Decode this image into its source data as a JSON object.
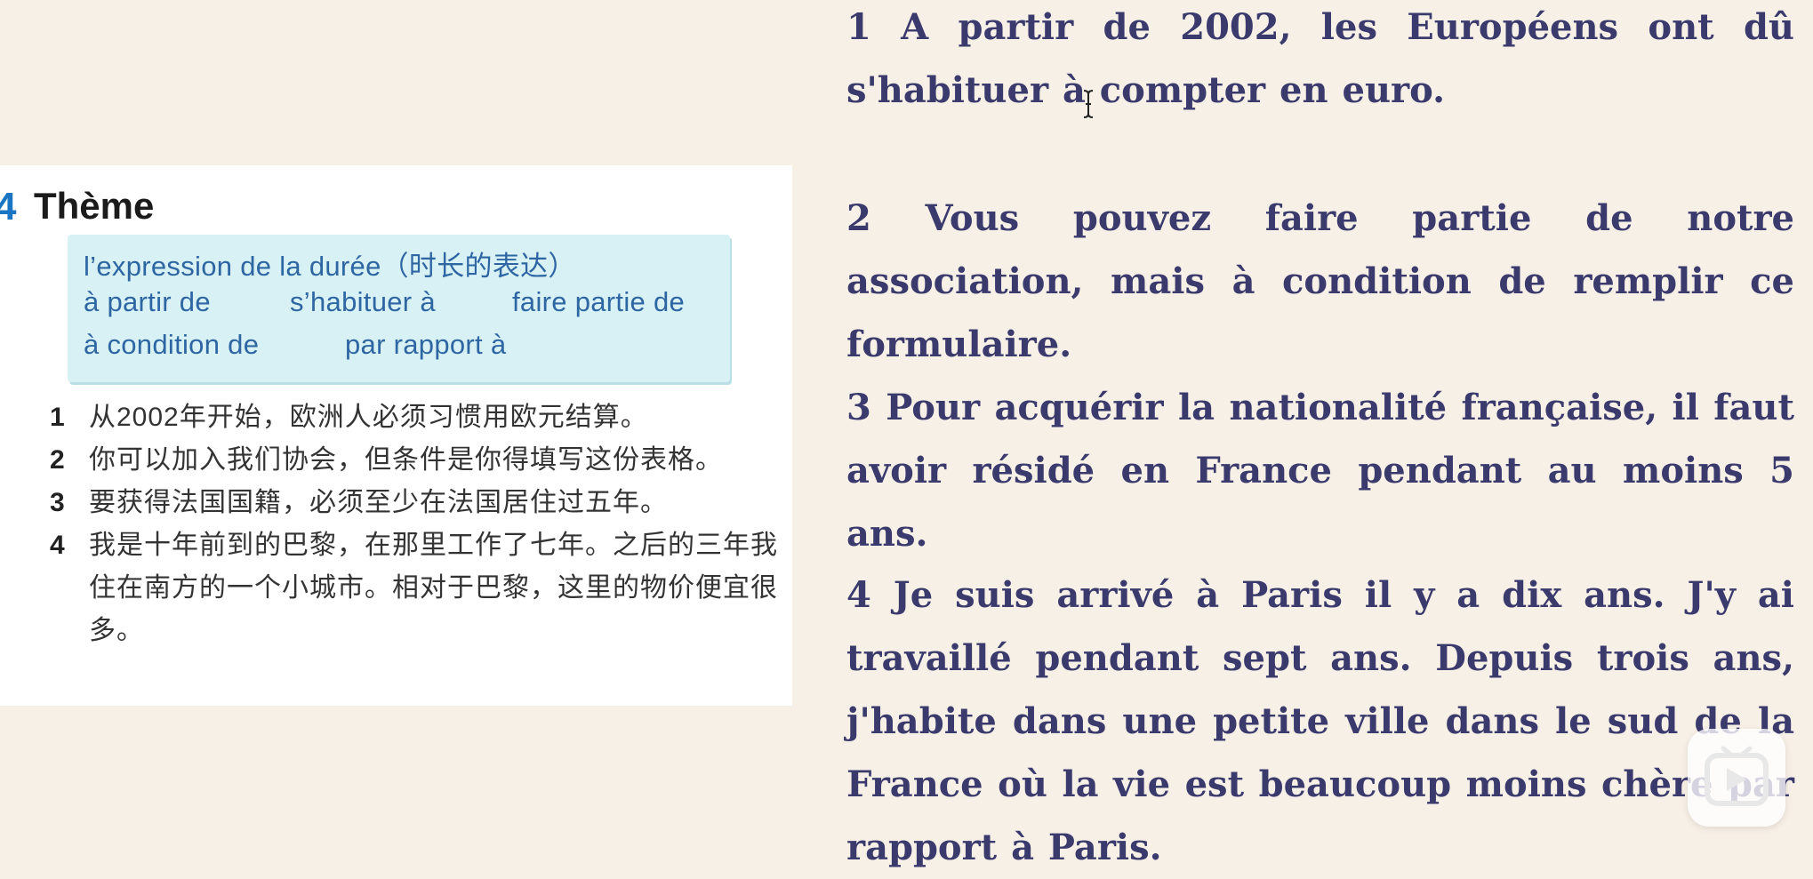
{
  "textbook": {
    "theme_number": "4",
    "theme_title": "Thème",
    "vocab_box": {
      "title": "l’expression de la durée（时长的表达）",
      "items": [
        "à partir de",
        "s’habituer à",
        "faire partie de",
        "à condition de",
        "par rapport à"
      ]
    },
    "exercises": [
      {
        "num": "1",
        "text": "从2002年开始，欧洲人必须习惯用欧元结算。"
      },
      {
        "num": "2",
        "text": "你可以加入我们协会，但条件是你得填写这份表格。"
      },
      {
        "num": "3",
        "text": "要获得法国国籍，必须至少在法国居住过五年。"
      },
      {
        "num": "4",
        "text": "我是十年前到的巴黎，在那里工作了七年。之后的三年我住在南方的一个小城市。相对于巴黎，这里的物价便宜很多。"
      }
    ]
  },
  "french": {
    "sentences": [
      "1 A partir de 2002, les Européens ont dû s'habituer à compter en euro.",
      "2 Vous pouvez faire partie de notre association, mais à condition de remplir ce formulaire.",
      "3 Pour acquérir la nationalité française, il faut avoir résidé en France pendant au moins 5 ans.",
      "4 Je suis arrivé à Paris il y a dix ans. J'y ai travaillé pendant sept ans. Depuis trois ans, j'habite dans une petite ville dans le sud de la France où la vie est beaucoup moins chère par rapport à Paris."
    ]
  },
  "colors": {
    "background": "#f7f0e7",
    "french_text": "#3b3a6d",
    "vocab_box_bg": "#d7f1f4",
    "vocab_text": "#2e66a3",
    "theme_number": "#1a76c2"
  },
  "icons": {
    "cursor": "text-cursor-icon",
    "play": "video-play-icon"
  }
}
